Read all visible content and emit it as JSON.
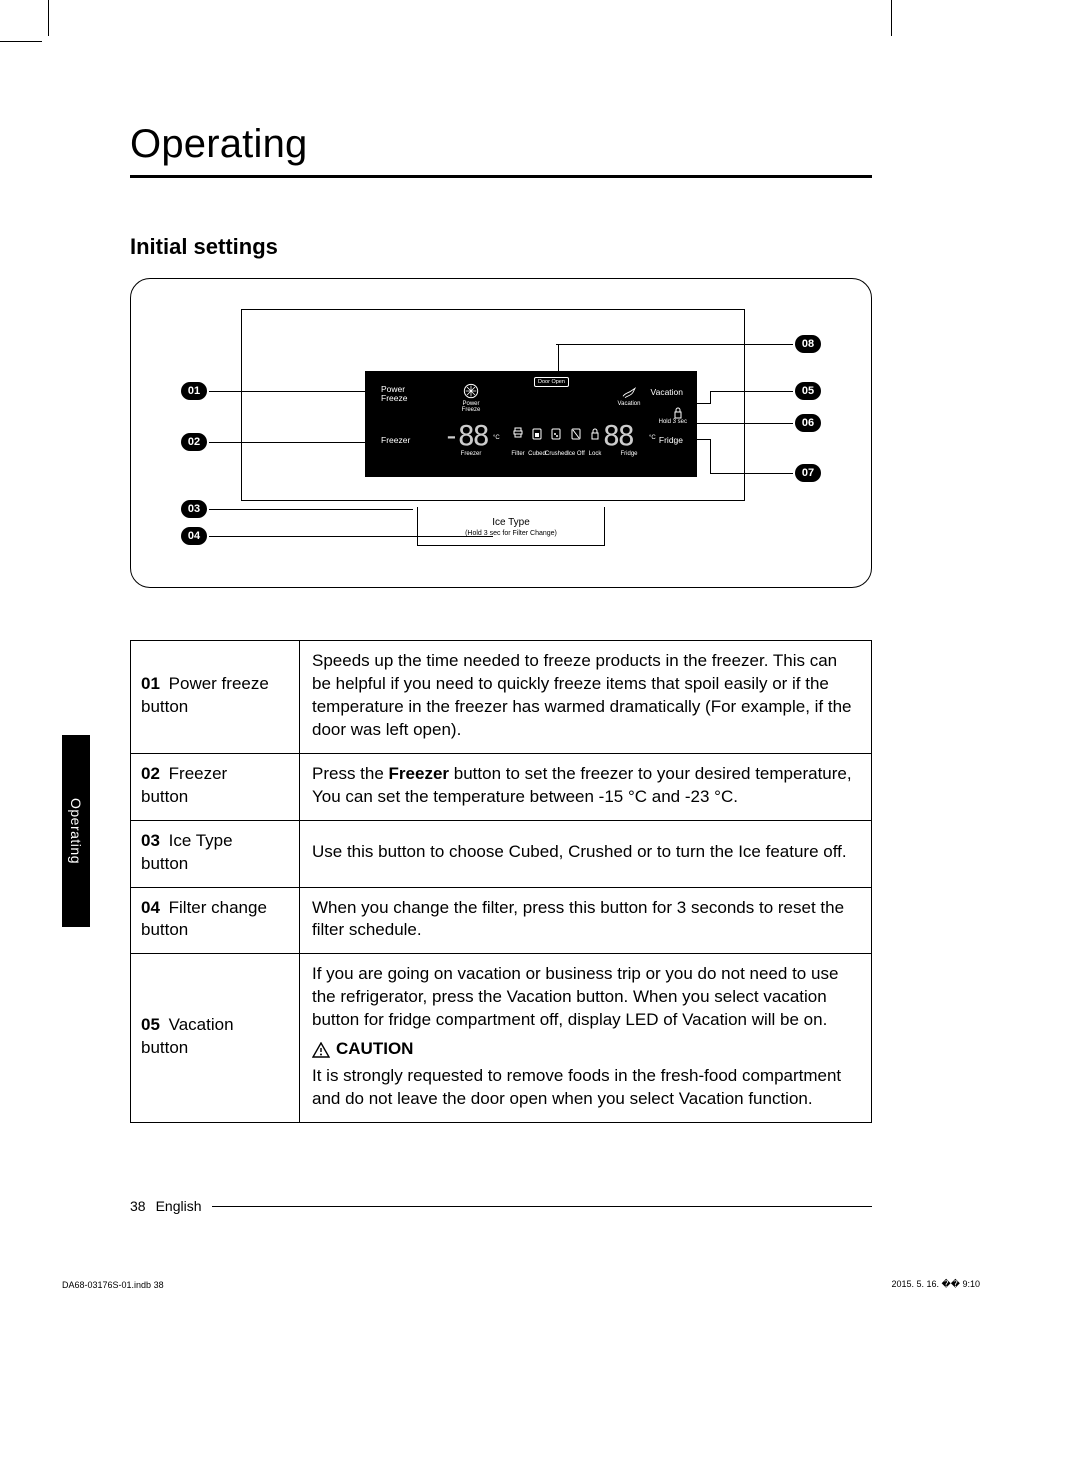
{
  "title": "Operating",
  "section": "Initial settings",
  "side_tab": "Operating",
  "diagram": {
    "callouts": [
      "01",
      "02",
      "03",
      "04",
      "05",
      "06",
      "07",
      "08"
    ],
    "panel": {
      "power_freeze_btn": "Power\nFreeze",
      "power_freeze_lbl": "Power Freeze",
      "freezer_btn": "Freezer",
      "freezer_lbl": "Freezer",
      "vacation_btn": "Vacation",
      "vacation_lbl": "Vacation",
      "fridge_btn": "Fridge",
      "fridge_lbl": "Fridge",
      "door_open": "Door Open",
      "hold3sec": "Hold 3 sec",
      "under": {
        "filter": "Filter",
        "cubed": "Cubed",
        "crushed": "Crushed",
        "iceoff": "Ice Off",
        "lock": "Lock"
      },
      "deg_c": "°C",
      "seg_left": "-88",
      "seg_right": "88"
    },
    "ice_type": {
      "title": "Ice Type",
      "sub": "(Hold 3 sec for Filter Change)"
    }
  },
  "table": [
    {
      "num": "01",
      "label": "Power freeze button",
      "desc_html": "Speeds up the time needed to freeze products in the freezer. This can be helpful if you need to quickly freeze items that spoil easily or if the temperature in the freezer has warmed dramatically (For example, if the door was left open)."
    },
    {
      "num": "02",
      "label": "Freezer button",
      "desc_html": "Press the <b>Freezer</b> button to set the freezer to your desired temperature, You can set the temperature between -15 °C and -23 °C."
    },
    {
      "num": "03",
      "label": "Ice Type button",
      "desc_html": "Use this button to choose Cubed, Crushed or to turn the Ice feature off."
    },
    {
      "num": "04",
      "label": "Filter change button",
      "desc_html": "When you change the filter, press this button for 3 seconds to reset the filter schedule."
    },
    {
      "num": "05",
      "label": "Vacation button",
      "desc_html": "If you are going on vacation or business trip or you do not need to use the refrigerator, press the Vacation button. When you select vacation button for fridge compartment off, display LED of Vacation will be on.",
      "caution_label": "CAUTION",
      "caution_text": "It is strongly requested to remove foods in the fresh-food compartment and do not leave the door open when you select Vacation function."
    }
  ],
  "footer": {
    "page_number": "38",
    "language": "English",
    "print_left": "DA68-03176S-01.indb   38",
    "print_right": "2015. 5. 16.   �� 9:10"
  }
}
